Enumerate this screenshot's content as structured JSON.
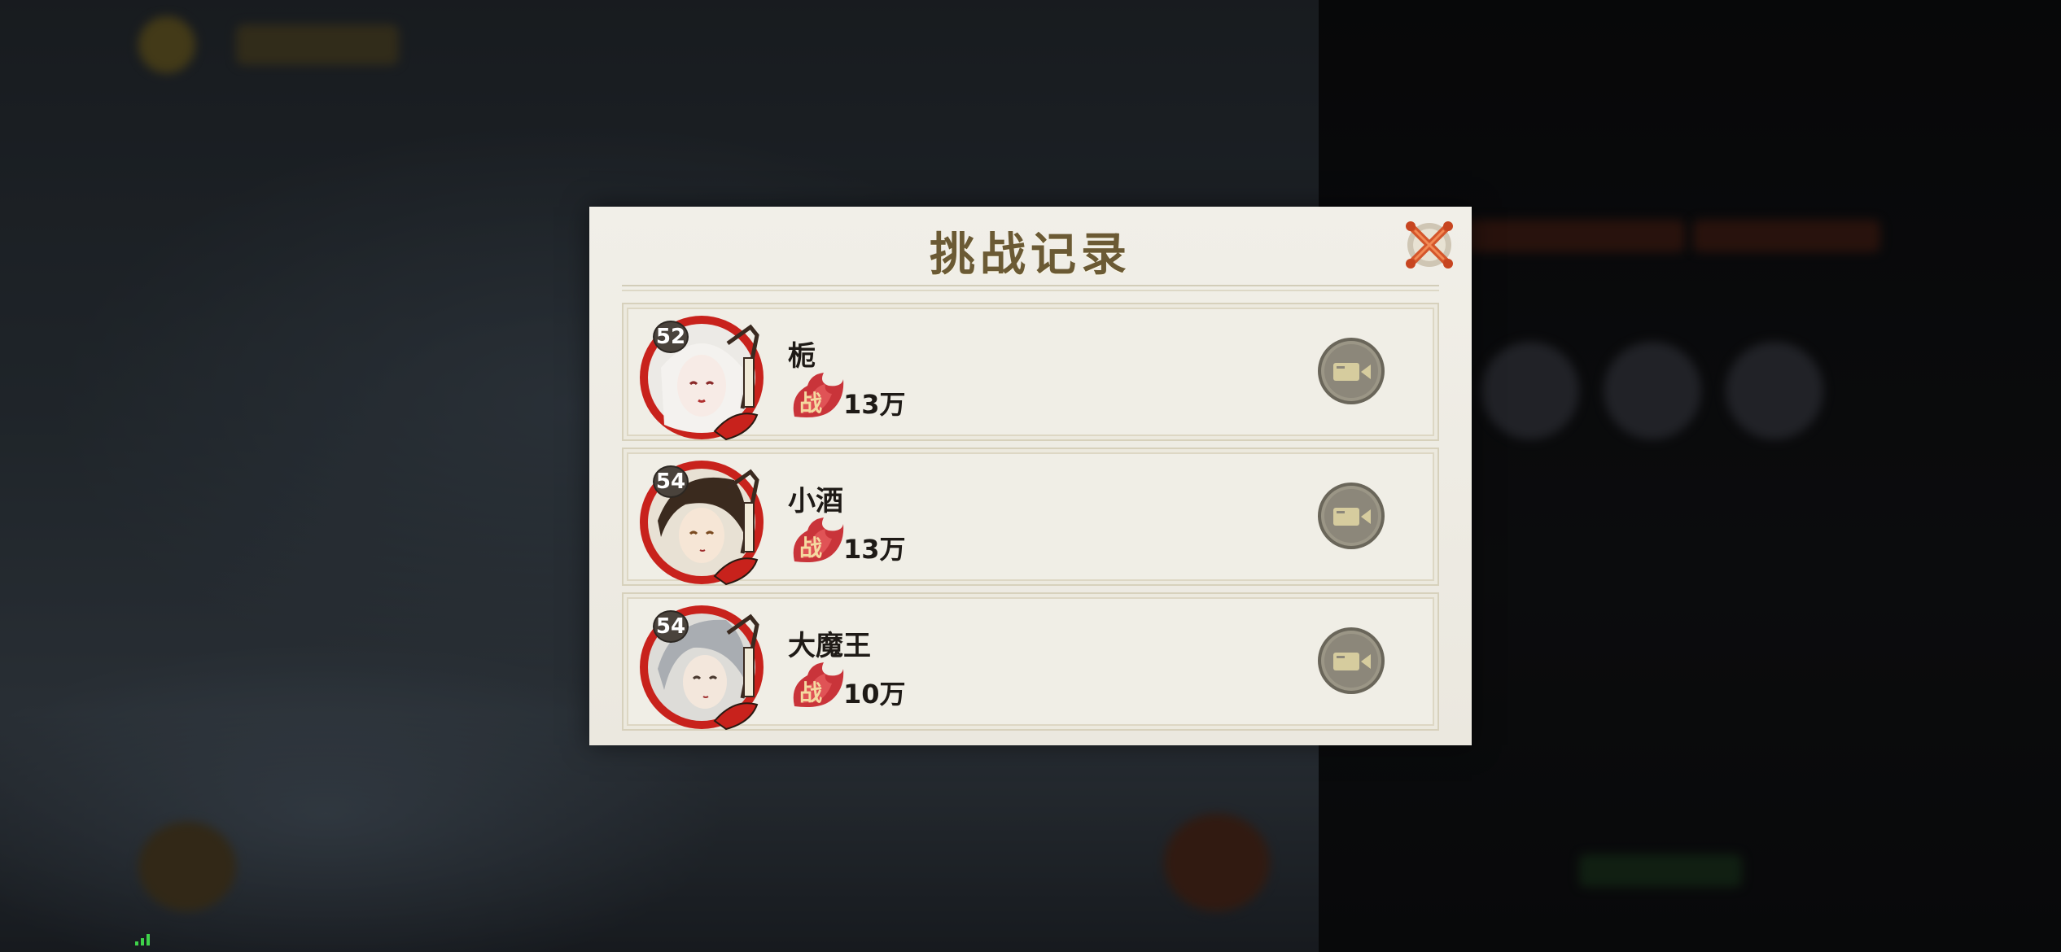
{
  "dialog": {
    "title": "挑战记录",
    "close_icon": "close-x-icon"
  },
  "records": [
    {
      "level": "52",
      "name": "栀",
      "power": "13万",
      "power_badge": "战",
      "replay_icon": "video-replay-icon"
    },
    {
      "level": "54",
      "name": "小酒",
      "power": "13万",
      "power_badge": "战",
      "replay_icon": "video-replay-icon"
    },
    {
      "level": "54",
      "name": "大魔王",
      "power": "10万",
      "power_badge": "战",
      "replay_icon": "video-replay-icon"
    }
  ],
  "colors": {
    "dialog_bg": "#efede5",
    "title": "#6b5a34",
    "avatar_ring": "#c8221c",
    "replay_button": "#8e8a7a",
    "close_accent": "#d4552a",
    "signal": "#3fd24a"
  }
}
